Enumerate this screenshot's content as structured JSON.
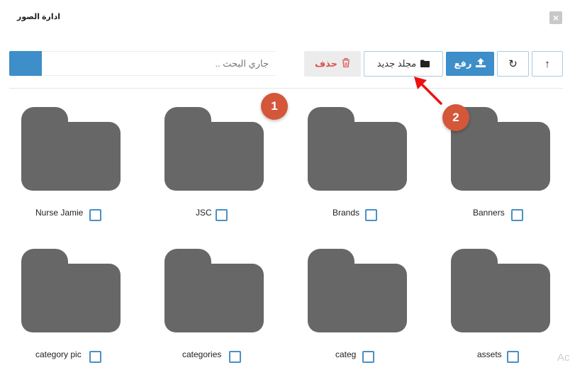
{
  "modal": {
    "title": "ادارة الصور",
    "close_glyph": "×"
  },
  "search": {
    "placeholder": "جاري البحث .."
  },
  "toolbar": {
    "delete_label": "حذف",
    "new_folder_label": "مجلد جديد",
    "upload_label": "رفع",
    "refresh_glyph": "↻",
    "up_glyph": "↑",
    "delete_icon": "trash-icon",
    "new_folder_icon": "folder-icon",
    "upload_icon": "upload-icon",
    "refresh_icon": "refresh-icon",
    "up_icon": "level-up-icon"
  },
  "annotations": [
    {
      "number": "1"
    },
    {
      "number": "2"
    }
  ],
  "folders": [
    {
      "name": "Nurse Jamie"
    },
    {
      "name": "JSC"
    },
    {
      "name": "Brands"
    },
    {
      "name": "Banners"
    },
    {
      "name": "category pic"
    },
    {
      "name": "categories"
    },
    {
      "name": "categ"
    },
    {
      "name": "assets"
    }
  ],
  "watermark": {
    "text": "Ac"
  },
  "colors": {
    "primary": "#3d8ec9",
    "danger": "#d9534f",
    "folder": "#676767",
    "badge": "#d4573a",
    "arrow": "#ee1111"
  }
}
